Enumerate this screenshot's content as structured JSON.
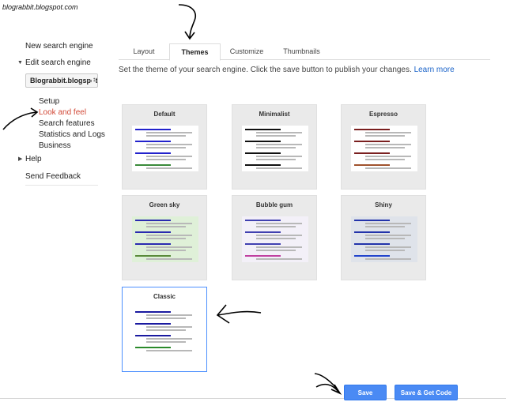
{
  "watermark": "blograbbit.blogspot.com",
  "sidebar": {
    "new_engine": "New search engine",
    "edit_engine": "Edit search engine",
    "site_select": "Blograbbit.blogspot.com",
    "sub_items": [
      "Setup",
      "Look and feel",
      "Search features",
      "Statistics and Logs",
      "Business"
    ],
    "active_item": "Look and feel",
    "help": "Help",
    "feedback": "Send Feedback"
  },
  "tabs": [
    "Layout",
    "Themes",
    "Customize",
    "Thumbnails"
  ],
  "active_tab": "Themes",
  "intro": {
    "text": "Set the theme of your search engine. Click the save button to publish your changes.",
    "link": "Learn more"
  },
  "themes": [
    {
      "name": "Default",
      "bg": "#ffffff",
      "accent": "#2222cc",
      "accent2": "#3a8a3a"
    },
    {
      "name": "Minimalist",
      "bg": "#ffffff",
      "accent": "#111111",
      "accent2": "#111111"
    },
    {
      "name": "Espresso",
      "bg": "#ffffff",
      "accent": "#7a1f1f",
      "accent2": "#a0522d"
    },
    {
      "name": "Green sky",
      "bg": "#dff0d8",
      "accent": "#2a2ab0",
      "accent2": "#5a8a3a"
    },
    {
      "name": "Bubble gum",
      "bg": "#f3f0f8",
      "accent": "#4040b0",
      "accent2": "#c040a0"
    },
    {
      "name": "Shiny",
      "bg": "#dfe3ea",
      "accent": "#2233aa",
      "accent2": "#2244cc"
    },
    {
      "name": "Classic",
      "bg": "#ffffff",
      "accent": "#1a1aa0",
      "accent2": "#2a8a2a"
    }
  ],
  "selected_theme": "Classic",
  "buttons": {
    "save": "Save",
    "save_get_code": "Save & Get Code"
  },
  "colors": {
    "accent_blue": "#4a8af4",
    "active_link": "#d14836",
    "link": "#1a63c9",
    "selected_border": "#4d90fe"
  }
}
